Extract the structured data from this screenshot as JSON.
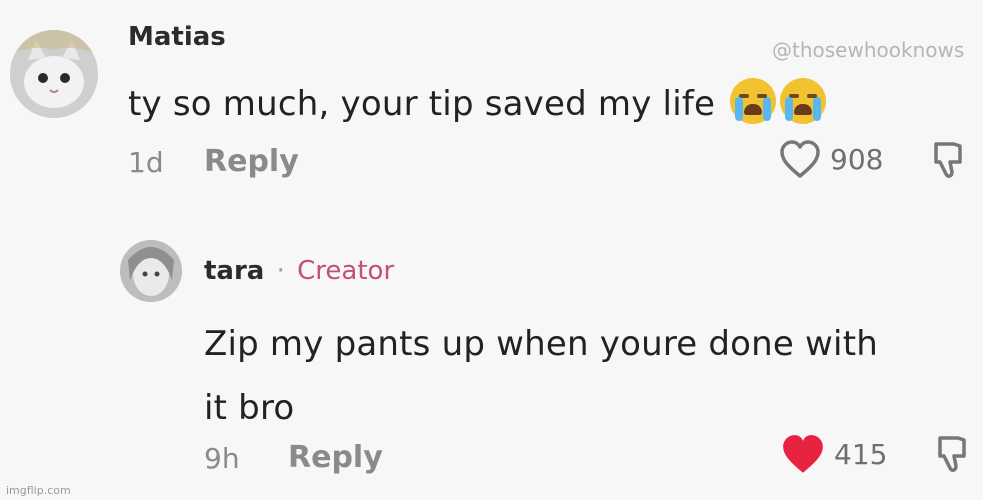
{
  "watermark": "@thosewhooknows",
  "footer_credit": "imgflip.com",
  "colors": {
    "background": "#f7f7f7",
    "like_active": "#e8233f",
    "muted": "#8a8a8a"
  },
  "comments": [
    {
      "username": "Matias",
      "text": "ty so much, your tip saved my life",
      "emoji": [
        "crying-face",
        "crying-face"
      ],
      "time": "1d",
      "reply_label": "Reply",
      "likes": "908",
      "liked": false,
      "like_icon": "heart-outline-icon",
      "dislike_icon": "thumbs-down-icon"
    },
    {
      "username": "tara",
      "separator": "·",
      "badge": "Creator",
      "text_line1": "Zip my pants up when youre done with",
      "text_line2": "it bro",
      "time": "9h",
      "reply_label": "Reply",
      "likes": "415",
      "liked": true,
      "like_icon": "heart-filled-icon",
      "dislike_icon": "thumbs-down-icon"
    }
  ]
}
